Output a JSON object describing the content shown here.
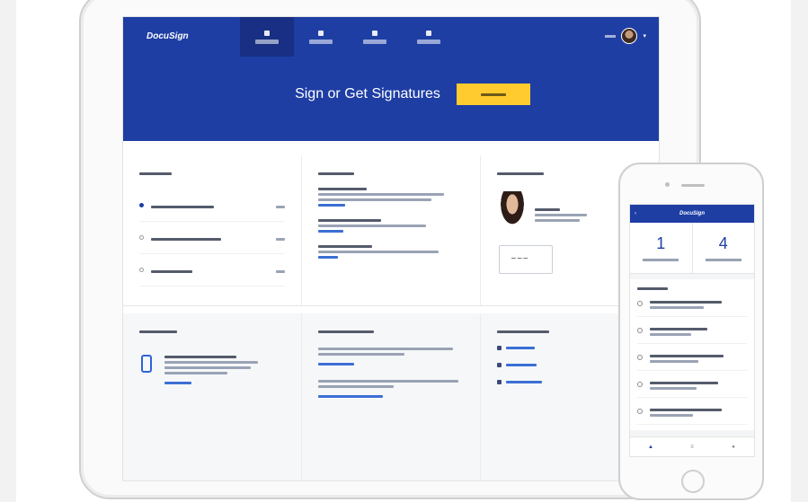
{
  "app": {
    "logo": "DocuSign"
  },
  "hero": {
    "title": "Sign or Get Signatures"
  },
  "icons": {
    "nav": [
      "home-icon",
      "documents-icon",
      "templates-icon",
      "reports-icon"
    ],
    "user_menu": "avatar-icon",
    "phone_tabs": [
      "home-icon",
      "menu-icon",
      "profile-icon"
    ]
  },
  "colors": {
    "brand_blue": "#1e3ea4",
    "cta_yellow": "#ffcb2e",
    "link_blue": "#3b6fd4"
  },
  "phone": {
    "logo": "DocuSign",
    "stats": [
      "1",
      "4"
    ]
  }
}
